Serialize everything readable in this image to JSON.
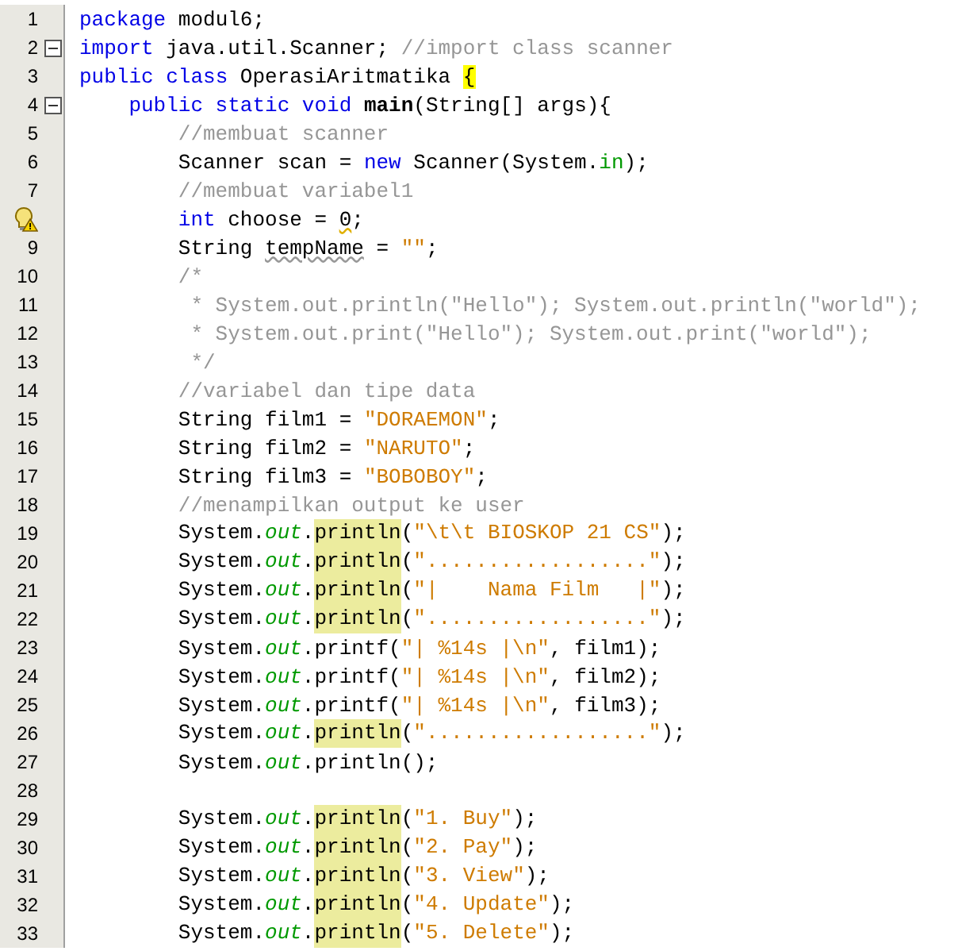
{
  "editor": {
    "lines": [
      {
        "number": "1",
        "kind": "top",
        "foldable": false,
        "warning": false,
        "tokens": [
          {
            "kind": "keyword",
            "text": "package"
          },
          {
            "kind": "plain",
            "text": " modul6;"
          }
        ]
      },
      {
        "number": "2",
        "kind": "top",
        "foldable": true,
        "warning": false,
        "tokens": [
          {
            "kind": "keyword",
            "text": "import"
          },
          {
            "kind": "plain",
            "text": " java.util.Scanner; "
          },
          {
            "kind": "comment",
            "text": "//import class scanner"
          }
        ]
      },
      {
        "number": "3",
        "kind": "top",
        "foldable": false,
        "warning": false,
        "tokens": [
          {
            "kind": "keyword",
            "text": "public class"
          },
          {
            "kind": "plain",
            "text": " OperasiAritmatika "
          },
          {
            "kind": "brace-match",
            "text": "{"
          }
        ]
      },
      {
        "number": "4",
        "kind": "member",
        "foldable": true,
        "warning": false,
        "tokens": [
          {
            "kind": "keyword",
            "text": "public static void "
          },
          {
            "kind": "declaration",
            "text": "main"
          },
          {
            "kind": "plain",
            "text": "(String[] args){"
          }
        ]
      },
      {
        "number": "5",
        "kind": "body",
        "foldable": false,
        "warning": false,
        "tokens": [
          {
            "kind": "comment",
            "text": "//membuat scanner"
          }
        ]
      },
      {
        "number": "6",
        "kind": "body",
        "foldable": false,
        "warning": false,
        "tokens": [
          {
            "kind": "plain",
            "text": "Scanner scan = "
          },
          {
            "kind": "keyword",
            "text": "new"
          },
          {
            "kind": "plain",
            "text": " Scanner(System."
          },
          {
            "kind": "field",
            "text": "in"
          },
          {
            "kind": "plain",
            "text": ");"
          }
        ]
      },
      {
        "number": "7",
        "kind": "body",
        "foldable": false,
        "warning": false,
        "tokens": [
          {
            "kind": "comment",
            "text": "//membuat variabel1"
          }
        ]
      },
      {
        "kind": "body",
        "foldable": false,
        "warning": true,
        "tokens": [
          {
            "kind": "keyword",
            "text": "int"
          },
          {
            "kind": "plain",
            "text": " choose = "
          },
          {
            "kind": "warning",
            "text": "0"
          },
          {
            "kind": "plain",
            "text": ";"
          }
        ]
      },
      {
        "number": "9",
        "kind": "body",
        "foldable": false,
        "warning": false,
        "tokens": [
          {
            "kind": "plain",
            "text": "String "
          },
          {
            "kind": "unused",
            "text": "tempName"
          },
          {
            "kind": "plain",
            "text": " = "
          },
          {
            "kind": "string",
            "text": "\"\""
          },
          {
            "kind": "plain",
            "text": ";"
          }
        ]
      },
      {
        "number": "10",
        "kind": "body",
        "foldable": false,
        "warning": false,
        "tokens": [
          {
            "kind": "comment",
            "text": "/*"
          }
        ]
      },
      {
        "number": "11",
        "kind": "body",
        "foldable": false,
        "warning": false,
        "tokens": [
          {
            "kind": "comment",
            "text": " * System.out.println(\"Hello\"); System.out.println(\"world\");"
          }
        ]
      },
      {
        "number": "12",
        "kind": "body",
        "foldable": false,
        "warning": false,
        "tokens": [
          {
            "kind": "comment",
            "text": " * System.out.print(\"Hello\"); System.out.print(\"world\");"
          }
        ]
      },
      {
        "number": "13",
        "kind": "body",
        "foldable": false,
        "warning": false,
        "tokens": [
          {
            "kind": "comment",
            "text": " */"
          }
        ]
      },
      {
        "number": "14",
        "kind": "body",
        "foldable": false,
        "warning": false,
        "tokens": [
          {
            "kind": "comment",
            "text": "//variabel dan tipe data"
          }
        ]
      },
      {
        "number": "15",
        "kind": "body",
        "foldable": false,
        "warning": false,
        "tokens": [
          {
            "kind": "plain",
            "text": "String film1 = "
          },
          {
            "kind": "string",
            "text": "\"DORAEMON\""
          },
          {
            "kind": "plain",
            "text": ";"
          }
        ]
      },
      {
        "number": "16",
        "kind": "body",
        "foldable": false,
        "warning": false,
        "tokens": [
          {
            "kind": "plain",
            "text": "String film2 = "
          },
          {
            "kind": "string",
            "text": "\"NARUTO\""
          },
          {
            "kind": "plain",
            "text": ";"
          }
        ]
      },
      {
        "number": "17",
        "kind": "body",
        "foldable": false,
        "warning": false,
        "tokens": [
          {
            "kind": "plain",
            "text": "String film3 = "
          },
          {
            "kind": "string",
            "text": "\"BOBOBOY\""
          },
          {
            "kind": "plain",
            "text": ";"
          }
        ]
      },
      {
        "number": "18",
        "kind": "body",
        "foldable": false,
        "warning": false,
        "tokens": [
          {
            "kind": "comment",
            "text": "//menampilkan output ke user"
          }
        ]
      },
      {
        "number": "19",
        "kind": "body",
        "foldable": false,
        "warning": false,
        "tokens": [
          {
            "kind": "plain",
            "text": "System."
          },
          {
            "kind": "field-static",
            "text": "out"
          },
          {
            "kind": "plain",
            "text": "."
          },
          {
            "kind": "occurrence",
            "text": "println"
          },
          {
            "kind": "plain",
            "text": "("
          },
          {
            "kind": "string",
            "text": "\"\\t\\t BIOSKOP 21 CS\""
          },
          {
            "kind": "plain",
            "text": ");"
          }
        ]
      },
      {
        "number": "20",
        "kind": "body",
        "foldable": false,
        "warning": false,
        "tokens": [
          {
            "kind": "plain",
            "text": "System."
          },
          {
            "kind": "field-static",
            "text": "out"
          },
          {
            "kind": "plain",
            "text": "."
          },
          {
            "kind": "occurrence",
            "text": "println"
          },
          {
            "kind": "plain",
            "text": "("
          },
          {
            "kind": "string",
            "text": "\"..................\""
          },
          {
            "kind": "plain",
            "text": ");"
          }
        ]
      },
      {
        "number": "21",
        "kind": "body",
        "foldable": false,
        "warning": false,
        "tokens": [
          {
            "kind": "plain",
            "text": "System."
          },
          {
            "kind": "field-static",
            "text": "out"
          },
          {
            "kind": "plain",
            "text": "."
          },
          {
            "kind": "occurrence",
            "text": "println"
          },
          {
            "kind": "plain",
            "text": "("
          },
          {
            "kind": "string",
            "text": "\"|    Nama Film   |\""
          },
          {
            "kind": "plain",
            "text": ");"
          }
        ]
      },
      {
        "number": "22",
        "kind": "body",
        "foldable": false,
        "warning": false,
        "tokens": [
          {
            "kind": "plain",
            "text": "System."
          },
          {
            "kind": "field-static",
            "text": "out"
          },
          {
            "kind": "plain",
            "text": "."
          },
          {
            "kind": "occurrence",
            "text": "println"
          },
          {
            "kind": "plain",
            "text": "("
          },
          {
            "kind": "string",
            "text": "\"..................\""
          },
          {
            "kind": "plain",
            "text": ");"
          }
        ]
      },
      {
        "number": "23",
        "kind": "body",
        "foldable": false,
        "warning": false,
        "tokens": [
          {
            "kind": "plain",
            "text": "System."
          },
          {
            "kind": "field-static",
            "text": "out"
          },
          {
            "kind": "plain",
            "text": ".printf("
          },
          {
            "kind": "string",
            "text": "\"| %14s |\\n\""
          },
          {
            "kind": "plain",
            "text": ", film1);"
          }
        ]
      },
      {
        "number": "24",
        "kind": "body",
        "foldable": false,
        "warning": false,
        "tokens": [
          {
            "kind": "plain",
            "text": "System."
          },
          {
            "kind": "field-static",
            "text": "out"
          },
          {
            "kind": "plain",
            "text": ".printf("
          },
          {
            "kind": "string",
            "text": "\"| %14s |\\n\""
          },
          {
            "kind": "plain",
            "text": ", film2);"
          }
        ]
      },
      {
        "number": "25",
        "kind": "body",
        "foldable": false,
        "warning": false,
        "tokens": [
          {
            "kind": "plain",
            "text": "System."
          },
          {
            "kind": "field-static",
            "text": "out"
          },
          {
            "kind": "plain",
            "text": ".printf("
          },
          {
            "kind": "string",
            "text": "\"| %14s |\\n\""
          },
          {
            "kind": "plain",
            "text": ", film3);"
          }
        ]
      },
      {
        "number": "26",
        "kind": "body",
        "foldable": false,
        "warning": false,
        "tokens": [
          {
            "kind": "plain",
            "text": "System."
          },
          {
            "kind": "field-static",
            "text": "out"
          },
          {
            "kind": "plain",
            "text": "."
          },
          {
            "kind": "occurrence",
            "text": "println"
          },
          {
            "kind": "plain",
            "text": "("
          },
          {
            "kind": "string",
            "text": "\"..................\""
          },
          {
            "kind": "plain",
            "text": ");"
          }
        ]
      },
      {
        "number": "27",
        "kind": "body",
        "foldable": false,
        "warning": false,
        "tokens": [
          {
            "kind": "plain",
            "text": "System."
          },
          {
            "kind": "field-static",
            "text": "out"
          },
          {
            "kind": "plain",
            "text": ".println();"
          }
        ]
      },
      {
        "number": "28",
        "kind": "body",
        "foldable": false,
        "warning": false
      },
      {
        "number": "29",
        "kind": "body",
        "foldable": false,
        "warning": false,
        "tokens": [
          {
            "kind": "plain",
            "text": "System."
          },
          {
            "kind": "field-static",
            "text": "out"
          },
          {
            "kind": "plain",
            "text": "."
          },
          {
            "kind": "occurrence",
            "text": "println"
          },
          {
            "kind": "plain",
            "text": "("
          },
          {
            "kind": "string",
            "text": "\"1. Buy\""
          },
          {
            "kind": "plain",
            "text": ");"
          }
        ]
      },
      {
        "number": "30",
        "kind": "body",
        "foldable": false,
        "warning": false,
        "tokens": [
          {
            "kind": "plain",
            "text": "System."
          },
          {
            "kind": "field-static",
            "text": "out"
          },
          {
            "kind": "plain",
            "text": "."
          },
          {
            "kind": "occurrence",
            "text": "println"
          },
          {
            "kind": "plain",
            "text": "("
          },
          {
            "kind": "string",
            "text": "\"2. Pay\""
          },
          {
            "kind": "plain",
            "text": ");"
          }
        ]
      },
      {
        "number": "31",
        "kind": "body",
        "foldable": false,
        "warning": false,
        "tokens": [
          {
            "kind": "plain",
            "text": "System."
          },
          {
            "kind": "field-static",
            "text": "out"
          },
          {
            "kind": "plain",
            "text": "."
          },
          {
            "kind": "occurrence",
            "text": "println"
          },
          {
            "kind": "plain",
            "text": "("
          },
          {
            "kind": "string",
            "text": "\"3. View\""
          },
          {
            "kind": "plain",
            "text": ");"
          }
        ]
      },
      {
        "number": "32",
        "kind": "body",
        "foldable": false,
        "warning": false,
        "tokens": [
          {
            "kind": "plain",
            "text": "System."
          },
          {
            "kind": "field-static",
            "text": "out"
          },
          {
            "kind": "plain",
            "text": "."
          },
          {
            "kind": "occurrence",
            "text": "println"
          },
          {
            "kind": "plain",
            "text": "("
          },
          {
            "kind": "string",
            "text": "\"4. Update\""
          },
          {
            "kind": "plain",
            "text": ");"
          }
        ]
      },
      {
        "number": "33",
        "kind": "body",
        "foldable": false,
        "warning": false,
        "tokens": [
          {
            "kind": "plain",
            "text": "System."
          },
          {
            "kind": "field-static",
            "text": "out"
          },
          {
            "kind": "plain",
            "text": "."
          },
          {
            "kind": "occurrence",
            "text": "println"
          },
          {
            "kind": "plain",
            "text": "("
          },
          {
            "kind": "string",
            "text": "\"5. Delete\""
          },
          {
            "kind": "plain",
            "text": ");"
          }
        ]
      }
    ]
  }
}
